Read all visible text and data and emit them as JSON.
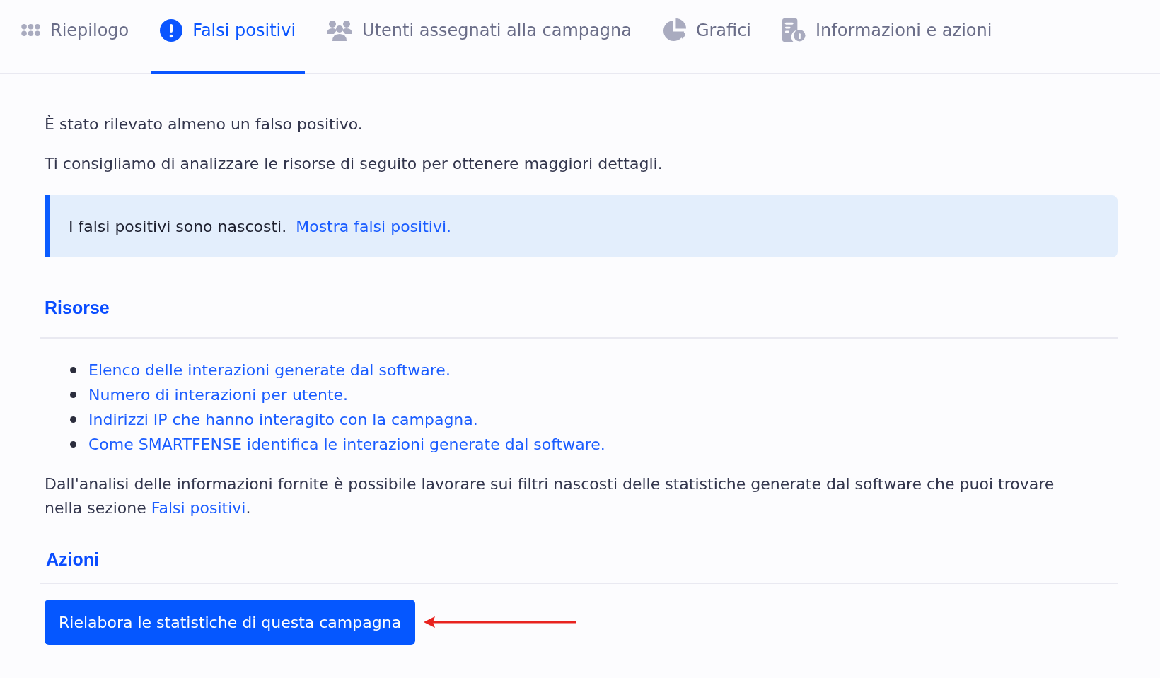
{
  "tabs": [
    {
      "label": "Riepilogo",
      "selected": false
    },
    {
      "label": "Falsi positivi",
      "selected": true
    },
    {
      "label": "Utenti assegnati alla campagna",
      "selected": false
    },
    {
      "label": "Grafici",
      "selected": false
    },
    {
      "label": "Informazioni e azioni",
      "selected": false
    }
  ],
  "intro": [
    "È stato rilevato almeno un falso positivo.",
    "Ti consigliamo di analizzare le risorse di seguito per ottenere maggiori dettagli."
  ],
  "notice": {
    "text": "I falsi positivi sono nascosti.",
    "link": "Mostra falsi positivi."
  },
  "resources": {
    "heading": "Risorse",
    "links": [
      "Elenco delle interazioni generate dal software.",
      "Numero di interazioni per utente.",
      "Indirizzi IP che hanno interagito con la campagna.",
      "Come SMARTFENSE identifica le interazioni generate dal software."
    ]
  },
  "note": {
    "text": "Dall'analisi delle informazioni fornite è possibile lavorare sui filtri nascosti delle statistiche generate dal software che puoi trovare nella sezione ",
    "link": "Falsi positivi",
    "end": "."
  },
  "actions": {
    "heading": "Azioni",
    "button": "Rielabora le statistiche di questa campagna"
  }
}
